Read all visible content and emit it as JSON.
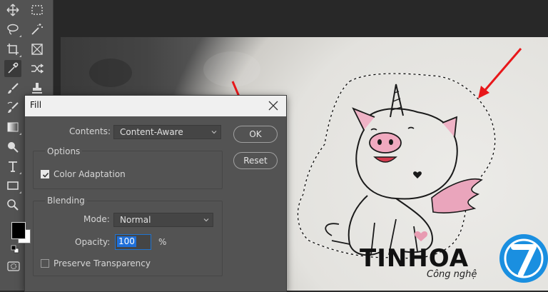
{
  "toolbar": {
    "tools": [
      {
        "icon": "move-icon"
      },
      {
        "icon": "marquee-icon"
      },
      {
        "icon": "lasso-icon"
      },
      {
        "icon": "magic-wand-icon"
      },
      {
        "icon": "crop-icon"
      },
      {
        "icon": "frame-icon"
      },
      {
        "icon": "eyedropper-icon"
      },
      {
        "icon": "content-aware-move-icon"
      },
      {
        "icon": "brush-icon"
      },
      {
        "icon": "clone-stamp-icon"
      },
      {
        "icon": "history-brush-icon"
      },
      {
        "icon": "gradient-icon"
      },
      {
        "icon": "dodge-icon"
      },
      {
        "icon": "type-icon"
      },
      {
        "icon": "rectangle-icon"
      },
      {
        "icon": "zoom-icon"
      }
    ],
    "foreground_color": "#000000",
    "background_color": "#ffffff"
  },
  "dialog": {
    "title": "Fill",
    "contents_label": "Contents:",
    "contents_value": "Content-Aware",
    "options_title": "Options",
    "color_adaptation_label": "Color Adaptation",
    "color_adaptation_checked": true,
    "blending_title": "Blending",
    "mode_label": "Mode:",
    "mode_value": "Normal",
    "opacity_label": "Opacity:",
    "opacity_value": "100",
    "opacity_unit": "%",
    "preserve_transparency_label": "Preserve Transparency",
    "preserve_transparency_checked": false,
    "ok_label": "OK",
    "reset_label": "Reset"
  },
  "watermark": {
    "brand": "TINHOA",
    "tagline": "Công nghệ",
    "logo_digit": "7",
    "brand_color": "#1a8fe0"
  },
  "annotation_color": "#e8171a"
}
